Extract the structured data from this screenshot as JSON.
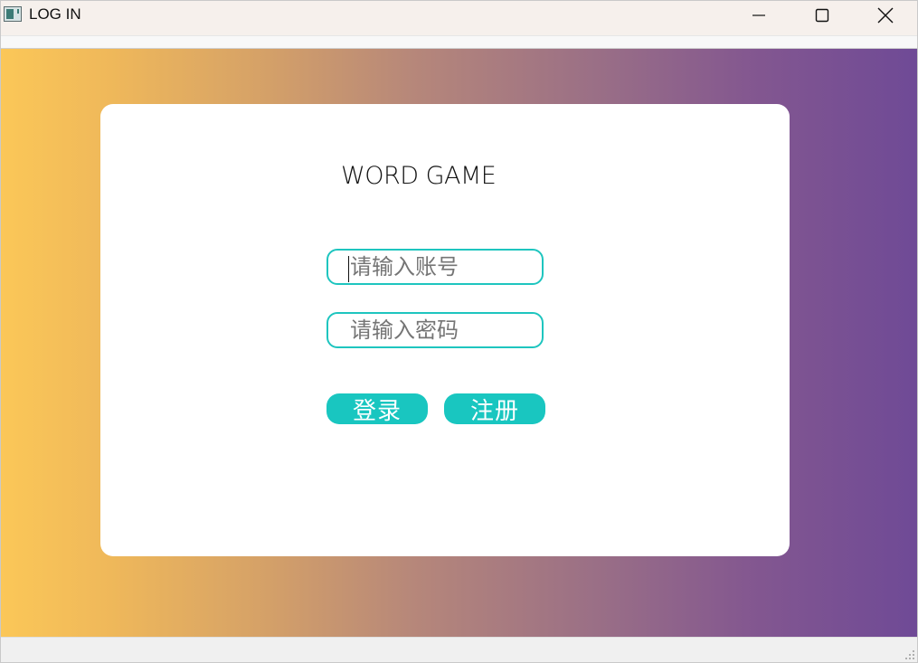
{
  "window": {
    "title": "LOG IN",
    "minimize_icon": "minimize-icon",
    "maximize_icon": "maximize-icon",
    "close_icon": "close-icon"
  },
  "colors": {
    "gradient_start": "#fbc758",
    "gradient_end": "#6f4a96",
    "accent": "#19c6c0",
    "card": "#ffffff"
  },
  "login_card": {
    "title": "WORD GAME",
    "username": {
      "value": "",
      "placeholder": "请输入账号"
    },
    "password": {
      "value": "",
      "placeholder": "请输入密码"
    },
    "login_label": "登录",
    "register_label": "注册"
  }
}
